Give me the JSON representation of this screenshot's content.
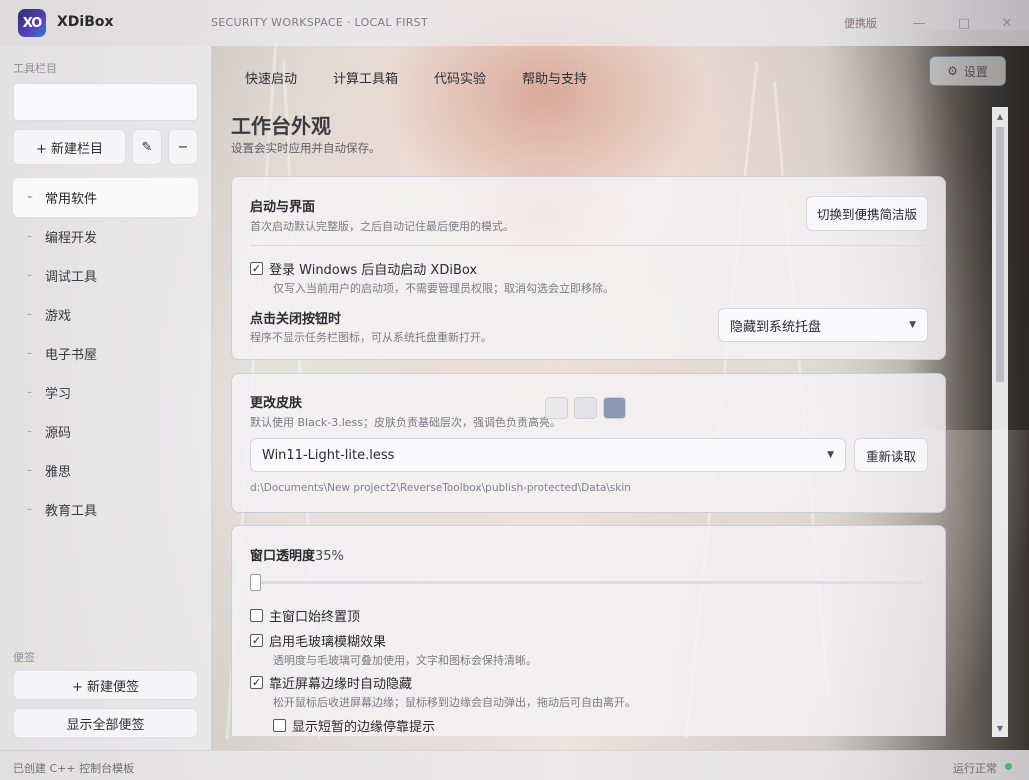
{
  "app": {
    "name": "XDiBox",
    "logo_text": "XO",
    "workspace_caption": "SECURITY WORKSPACE · LOCAL FIRST",
    "mode_link": "便携版",
    "window_controls": {
      "minimize": "—",
      "maximize": "□",
      "close": "✕"
    }
  },
  "sidebar": {
    "toolbar_label": "工具栏目",
    "new_category_label": "+ 新建栏目",
    "edit_icon": "✎",
    "remove_icon": "−",
    "items": [
      {
        "label": "常用软件",
        "active": true
      },
      {
        "label": "编程开发"
      },
      {
        "label": "调试工具"
      },
      {
        "label": "游戏"
      },
      {
        "label": "电子书屋"
      },
      {
        "label": "学习"
      },
      {
        "label": "源码"
      },
      {
        "label": "雅思"
      },
      {
        "label": "教育工具"
      }
    ],
    "notes_label": "便签",
    "new_note_label": "+ 新建便签",
    "show_notes_label": "显示全部便签"
  },
  "tabs": [
    {
      "label": "快速启动"
    },
    {
      "label": "计算工具箱"
    },
    {
      "label": "代码实验"
    },
    {
      "label": "帮助与支持"
    }
  ],
  "settings_button": {
    "icon": "⚙",
    "label": "设置"
  },
  "page": {
    "title": "工作台外观",
    "subtitle": "设置会实时应用并自动保存。"
  },
  "startup_card": {
    "title": "启动与界面",
    "desc": "首次启动默认完整版，之后自动记住最后使用的模式。",
    "switch_button": "切换到便携简洁版",
    "autostart_label": "登录 Windows 后自动启动 XDiBox",
    "autostart_checked": true,
    "autostart_desc": "仅写入当前用户的启动项，不需要管理员权限；取消勾选会立即移除。",
    "close_action_title": "点击关闭按钮时",
    "close_action_desc": "程序不显示任务栏图标，可从系统托盘重新打开。",
    "close_action_value": "隐藏到系统托盘"
  },
  "skin_card": {
    "title": "更改皮肤",
    "desc": "默认使用 Black-3.less；皮肤负责基础层次，强调色负责高亮。",
    "swatch_colors": [
      "#e9e8ec",
      "#e4e3e7",
      "#8b97b3"
    ],
    "skin_value": "Win11-Light-lite.less",
    "reload_button": "重新读取",
    "path": "d:\\Documents\\New project2\\ReverseToolbox\\publish-protected\\Data\\skin"
  },
  "window_card": {
    "opacity_label": "窗口透明度",
    "opacity_value": "35%",
    "opacity_level": 0.0,
    "always_on_top_label": "主窗口始终置顶",
    "always_on_top_checked": false,
    "blur_label": "启用毛玻璃模糊效果",
    "blur_checked": true,
    "blur_desc": "透明度与毛玻璃可叠加使用，文字和图标会保持清晰。",
    "edge_hide_label": "靠近屏幕边缘时自动隐藏",
    "edge_hide_checked": true,
    "edge_hide_desc": "松开鼠标后收进屏幕边缘；鼠标移到边缘会自动弹出，拖动后可自由离开。",
    "edge_hint_label": "显示短暂的边缘停靠提示",
    "edge_hint_checked": false
  },
  "statusbar": {
    "left": "已创建 C++ 控制台模板",
    "right": "运行正常"
  }
}
